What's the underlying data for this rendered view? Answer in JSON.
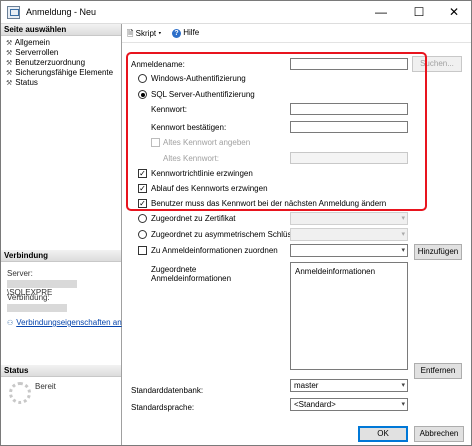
{
  "window": {
    "title": "Anmeldung - Neu",
    "minimize": "—",
    "maximize": "☐",
    "close": "✕"
  },
  "sidebar": {
    "section_header": "Seite auswählen",
    "pages": [
      {
        "label": "Allgemein",
        "icon": "wrench-icon"
      },
      {
        "label": "Serverrollen",
        "icon": "wrench-icon"
      },
      {
        "label": "Benutzerzuordnung",
        "icon": "wrench-icon"
      },
      {
        "label": "Sicherungsfähige Elemente",
        "icon": "wrench-icon"
      },
      {
        "label": "Status",
        "icon": "wrench-icon"
      }
    ],
    "connection_header": "Verbindung",
    "server_label": "Server:",
    "server_value": "\\SQLEXPRE",
    "connection_label": "Verbindung:",
    "connection_properties_link": "Verbindungseigenschaften an",
    "status_header": "Status",
    "status_value": "Bereit"
  },
  "toolbar": {
    "script_label": "Skript",
    "help_label": "Hilfe"
  },
  "form": {
    "login_name_label": "Anmeldename:",
    "search_button": "Suchen...",
    "windows_auth": "Windows-Authentifizierung",
    "sql_auth": "SQL Server-Authentifizierung",
    "password_label": "Kennwort:",
    "confirm_password_label": "Kennwort bestätigen:",
    "old_password_check": "Altes Kennwort angeben",
    "old_password_label": "Altes Kennwort:",
    "enforce_policy": "Kennwortrichtlinie erzwingen",
    "enforce_expiration": "Ablauf des Kennworts erzwingen",
    "must_change": "Benutzer muss das Kennwort bei der nächsten Anmeldung ändern",
    "mapped_certificate": "Zugeordnet zu Zertifikat",
    "mapped_asymmetric_key": "Zugeordnet zu asymmetrischem Schlüssel",
    "map_credentials": "Zu Anmeldeinformationen zuordnen",
    "add_button": "Hinzufügen",
    "mapped_credentials_label_line1": "Zugeordnete",
    "mapped_credentials_label_line2": "Anmeldeinformationen",
    "credentials_column": "Anmeldeinformationen",
    "remove_button": "Entfernen",
    "default_database_label": "Standarddatenbank:",
    "default_database_value": "master",
    "default_language_label": "Standardsprache:",
    "default_language_value": "<Standard>"
  },
  "footer": {
    "ok_button": "OK",
    "cancel_button": "Abbrechen"
  },
  "colors": {
    "highlight_border": "#e8141e",
    "link": "#0645ad"
  }
}
